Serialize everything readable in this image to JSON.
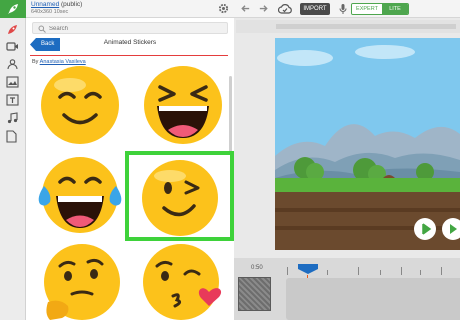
{
  "topbar": {
    "project_name": "Unnamed",
    "project_visibility": "(public)",
    "project_meta": "640x360 10sec",
    "import_label": "IMPORT",
    "mode_expert": "EXPERT",
    "mode_lite": "LITE"
  },
  "panel": {
    "search_placeholder": "Search",
    "back_label": "Back",
    "title": "Animated Stickers",
    "by_prefix": "By",
    "author": "Anastasia Vasileva"
  },
  "stickers": [
    {
      "name": "smiling-face"
    },
    {
      "name": "laughing-squint-face"
    },
    {
      "name": "tears-of-joy-face"
    },
    {
      "name": "winking-face",
      "selected": true
    },
    {
      "name": "thinking-face"
    },
    {
      "name": "kissing-heart-face"
    }
  ],
  "timeline": {
    "time_label": "0:50"
  },
  "colors": {
    "brand_green": "#43a643",
    "selection_green": "#3ed23a",
    "back_blue": "#1d6cc1",
    "divider_red": "#e43d3d",
    "playhead_blue": "#1d6cc1",
    "emoji_yellow": "#fcc21b"
  }
}
